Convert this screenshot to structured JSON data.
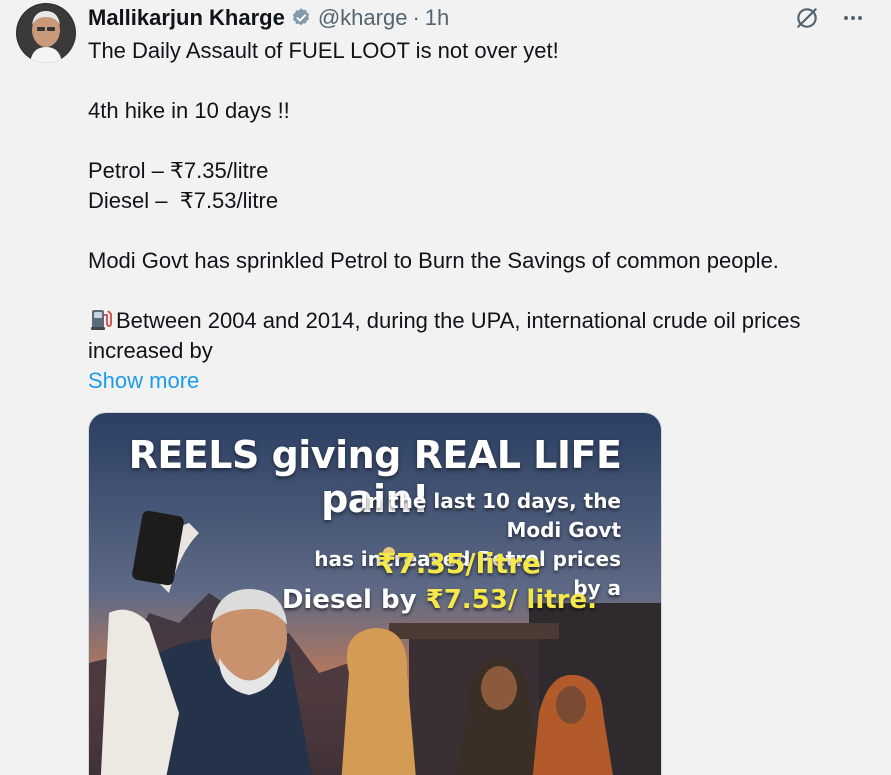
{
  "author": {
    "name": "Mallikarjun Kharge",
    "handle": "@kharge",
    "separator": "·",
    "time": "1h"
  },
  "tweet": {
    "line1": "The Daily Assault of FUEL LOOT is not over yet!",
    "line2": "4th hike in 10 days !!",
    "line3": "Petrol – ₹7.35/litre",
    "line4": "Diesel –  ₹7.53/litre",
    "line5": "Modi Govt has sprinkled Petrol to Burn the Savings of common people.",
    "line6": "Between 2004 and 2014, during the UPA, international crude oil prices",
    "line7": "increased by",
    "show_more": "Show more"
  },
  "media": {
    "headline": "REELS giving REAL LIFE pain!",
    "sub_line1": "In the last 10 days, the Modi Govt",
    "sub_line2": "has increased Petrol prices by a",
    "price": "₹7.35/litre",
    "diesel_prefix": "Diesel by ",
    "diesel_value": "₹7.53/ litre."
  },
  "colors": {
    "link": "#1d9bf0",
    "verified": "#829aab",
    "secondary": "#536471",
    "highlight": "#f5e84a"
  },
  "icons": {
    "verified": "verified-badge-icon",
    "grok": "grok-icon",
    "more": "more-dots-icon",
    "fuel": "fuel-pump-icon"
  }
}
